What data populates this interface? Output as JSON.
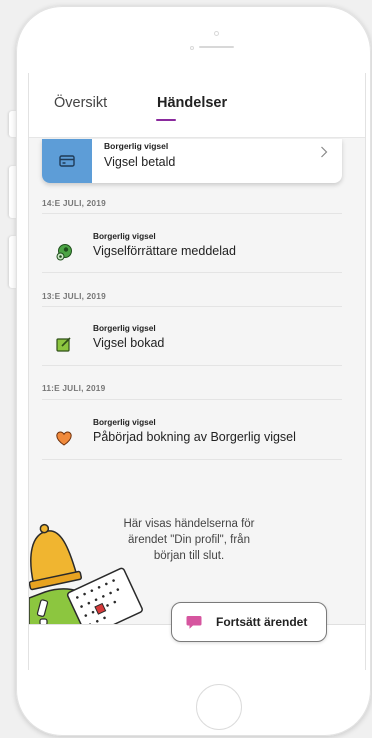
{
  "tabs": {
    "overview": "Översikt",
    "events": "Händelser"
  },
  "colors": {
    "accent": "#8a2a9d",
    "card_icon_bg": "#5d9dd7",
    "chat_icon": "#d6559f"
  },
  "top_event": {
    "category": "Borgerlig vigsel",
    "title": "Vigsel betald",
    "icon": "credit-card-icon"
  },
  "groups": [
    {
      "date": "14:E JULI, 2019",
      "event": {
        "category": "Borgerlig vigsel",
        "title": "Vigselförrättare meddelad",
        "icon": "officiant-icon"
      }
    },
    {
      "date": "13:E JULI, 2019",
      "event": {
        "category": "Borgerlig vigsel",
        "title": "Vigsel bokad",
        "icon": "edit-note-icon"
      }
    },
    {
      "date": "11:E JULI, 2019",
      "event": {
        "category": "Borgerlig vigsel",
        "title": "Påbörjad bokning av Borgerlig vigsel",
        "icon": "heart-icon"
      }
    }
  ],
  "info": {
    "line1": "Här visas händelserna för",
    "line2": "ärendet \"Din profil\", från",
    "line3": "början till slut."
  },
  "continue_button": {
    "label": "Fortsätt ärendet",
    "icon": "chat-bubble-icon"
  }
}
